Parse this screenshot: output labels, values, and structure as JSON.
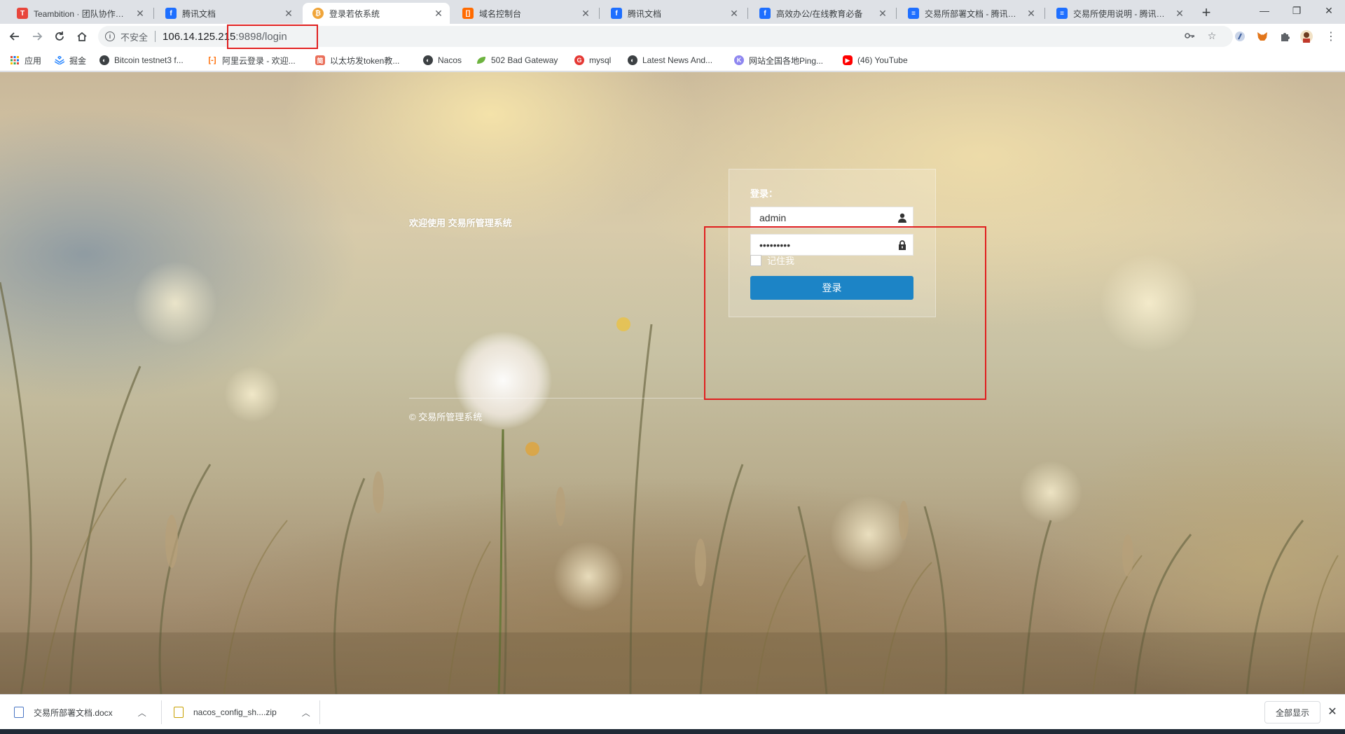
{
  "tabs": [
    {
      "title": "Teambition · 团队协作工具",
      "favicon_color": "#e8463c",
      "favicon_glyph": "Tb"
    },
    {
      "title": "腾讯文档",
      "favicon_color": "#1e6fff",
      "favicon_glyph": "腾"
    },
    {
      "title": "登录若依系统",
      "favicon_color": "#f0a53a",
      "favicon_glyph": "₿",
      "active": true
    },
    {
      "title": "域名控制台",
      "favicon_color": "#ff6a00",
      "favicon_glyph": "[-]"
    },
    {
      "title": "腾讯文档",
      "favicon_color": "#1e6fff",
      "favicon_glyph": "腾"
    },
    {
      "title": "高效办公/在线教育必备",
      "favicon_color": "#1e6fff",
      "favicon_glyph": "腾"
    },
    {
      "title": "交易所部署文档 - 腾讯文档",
      "favicon_color": "#1e6fff",
      "favicon_glyph": "≡"
    },
    {
      "title": "交易所使用说明 - 腾讯文档",
      "favicon_color": "#1e6fff",
      "favicon_glyph": "≡"
    }
  ],
  "address": {
    "security_label": "不安全",
    "host": "106.14.125.215",
    "path": ":9898/login"
  },
  "bookmarks": [
    {
      "label": "应用",
      "icon": "apps-grid-icon",
      "color": "#e04a3a"
    },
    {
      "label": "掘金",
      "icon": "juejin-icon",
      "color": "#1e80ff"
    },
    {
      "label": "Bitcoin testnet3 f...",
      "icon": "globe-icon",
      "color": "#3c4043"
    },
    {
      "label": "阿里云登录 - 欢迎...",
      "icon": "aliyun-icon",
      "color": "#ff6a00"
    },
    {
      "label": "以太坊发token教...",
      "icon": "jianshu-icon",
      "color": "#ea6f5a"
    },
    {
      "label": "Nacos",
      "icon": "globe-icon",
      "color": "#3c4043"
    },
    {
      "label": "502 Bad Gateway",
      "icon": "leaf-icon",
      "color": "#6db33f"
    },
    {
      "label": "mysql",
      "icon": "g-icon",
      "color": "#e53935"
    },
    {
      "label": "Latest News And...",
      "icon": "globe-icon",
      "color": "#3c4043"
    },
    {
      "label": "网站全国各地Ping...",
      "icon": "ping-icon",
      "color": "#8e86f0"
    },
    {
      "label": "(46) YouTube",
      "icon": "youtube-icon",
      "color": "#ff0000"
    }
  ],
  "page": {
    "welcome": "欢迎使用 交易所管理系统",
    "copyright": "© 交易所管理系统",
    "login": {
      "title": "登录：",
      "username_value": "admin",
      "password_value": "•••••••••",
      "remember_label": "记住我",
      "submit_label": "登录"
    }
  },
  "downloads": [
    {
      "name": "交易所部署文档.docx"
    },
    {
      "name": "nacos_config_sh....zip"
    }
  ],
  "download_bar": {
    "show_all_label": "全部显示"
  },
  "colors": {
    "login_button": "#1c84c6",
    "annotation_box": "#e01f1f"
  }
}
